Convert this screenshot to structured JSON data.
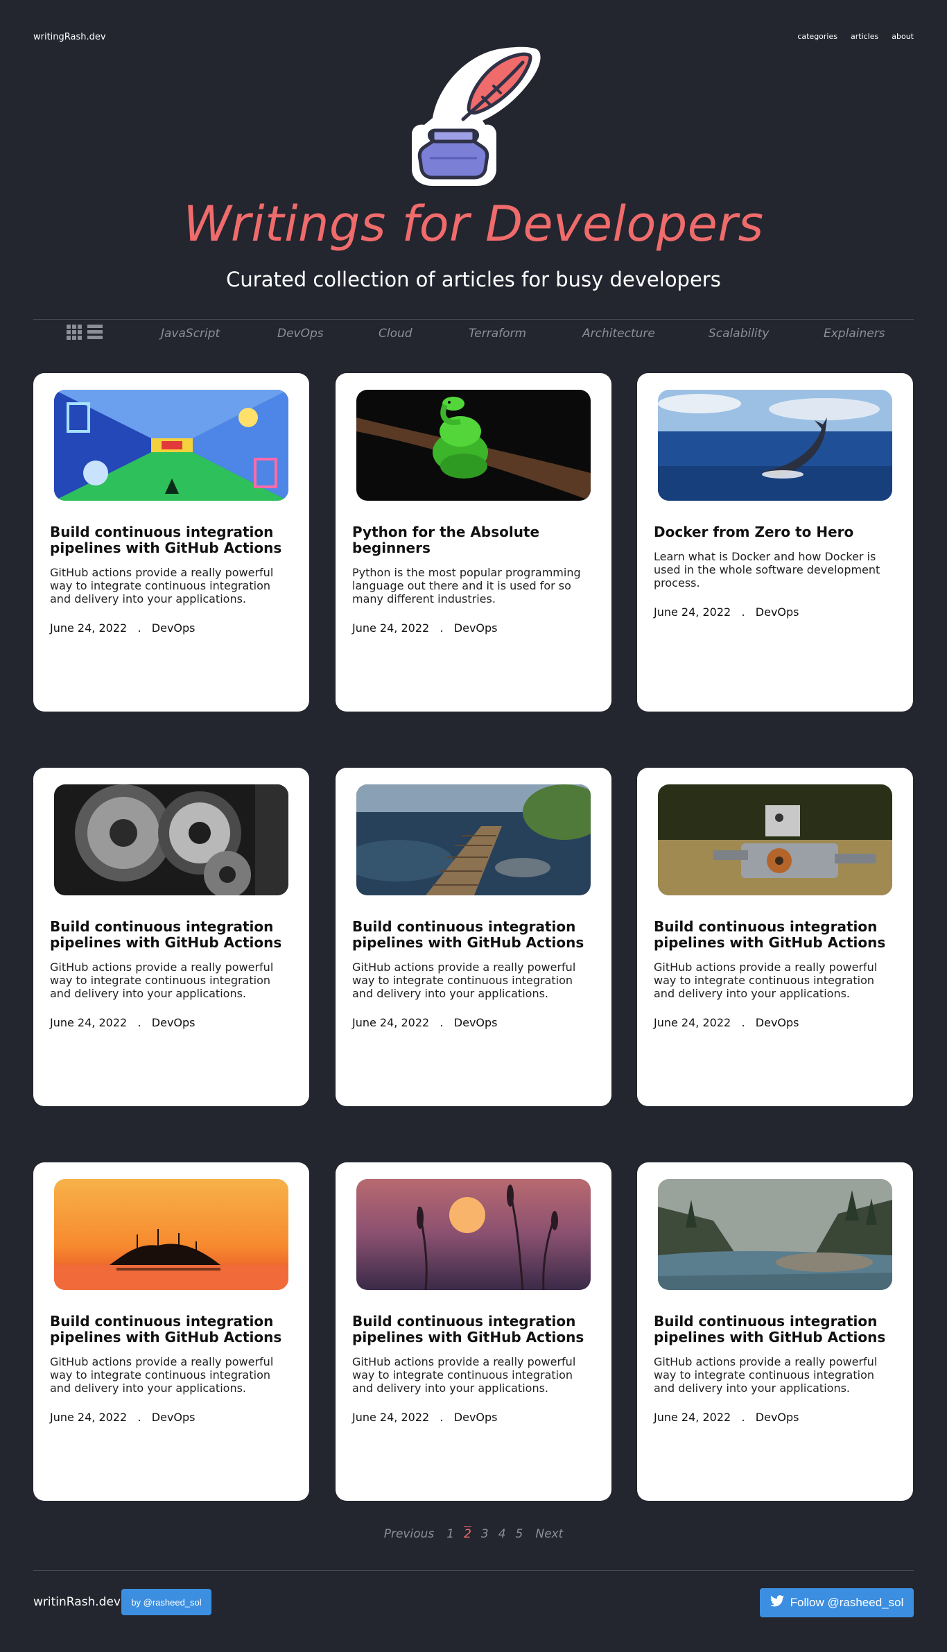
{
  "header": {
    "brand": "writingRash.dev",
    "nav": [
      "categories",
      "articles",
      "about"
    ]
  },
  "hero": {
    "title": "Writings for Developers",
    "subtitle": "Curated collection of articles for busy developers",
    "logo_icon": "quill-inkpot-icon"
  },
  "categories": [
    "JavaScript",
    "DevOps",
    "Cloud",
    "Terraform",
    "Architecture",
    "Scalability",
    "Explainers"
  ],
  "articles": [
    {
      "title": "Build continuous integration pipelines with GitHub Actions",
      "description": "GitHub actions provide a really powerful way to integrate continuous integration and delivery into your applications.",
      "date": "June 24, 2022",
      "category": "DevOps",
      "image": "abstract-corridor"
    },
    {
      "title": "Python for the Absolute beginners",
      "description": "Python is the most popular programming language out there and it is used for so many different industries.",
      "date": "June 24, 2022",
      "category": "DevOps",
      "image": "green-python"
    },
    {
      "title": "Docker from Zero to Hero",
      "description": "Learn what is Docker and how Docker is used in the whole software development process.",
      "date": "June 24, 2022",
      "category": "DevOps",
      "image": "whale-tail"
    },
    {
      "title": "Build continuous integration pipelines with GitHub Actions",
      "description": "GitHub actions provide a really powerful way to integrate continuous integration and delivery into your applications.",
      "date": "June 24, 2022",
      "category": "DevOps",
      "image": "gears"
    },
    {
      "title": "Build continuous integration pipelines with GitHub Actions",
      "description": "GitHub actions provide a really powerful way to integrate continuous integration and delivery into your applications.",
      "date": "June 24, 2022",
      "category": "DevOps",
      "image": "boardwalk-water"
    },
    {
      "title": "Build continuous integration pipelines with GitHub Actions",
      "description": "GitHub actions provide a really powerful way to integrate continuous integration and delivery into your applications.",
      "date": "June 24, 2022",
      "category": "DevOps",
      "image": "toy-robot"
    },
    {
      "title": "Build continuous integration pipelines with GitHub Actions",
      "description": "GitHub actions provide a really powerful way to integrate continuous integration and delivery into your applications.",
      "date": "June 24, 2022",
      "category": "DevOps",
      "image": "sunset-island"
    },
    {
      "title": "Build continuous integration pipelines with GitHub Actions",
      "description": "GitHub actions provide a really powerful way to integrate continuous integration and delivery into your applications.",
      "date": "June 24, 2022",
      "category": "DevOps",
      "image": "sunset-grass"
    },
    {
      "title": "Build continuous integration pipelines with GitHub Actions",
      "description": "GitHub actions provide a really powerful way to integrate continuous integration and delivery into your applications.",
      "date": "June 24, 2022",
      "category": "DevOps",
      "image": "misty-river"
    }
  ],
  "pagination": {
    "previous": "Previous",
    "pages": [
      "1",
      "2",
      "3",
      "4",
      "5"
    ],
    "current": "2",
    "next": "Next"
  },
  "footer": {
    "brand": "writinRash.dev",
    "by_label": "by @rasheed_sol",
    "follow_label": "Follow @rasheed_sol",
    "follow_icon": "twitter-bird-icon"
  },
  "colors": {
    "background": "#23252f",
    "accent": "#f06b6b",
    "button": "#3c8fe0",
    "muted": "#8b8e98"
  }
}
